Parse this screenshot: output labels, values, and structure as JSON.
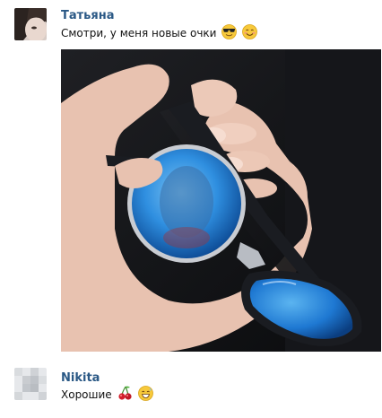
{
  "messages": [
    {
      "author": "Татьяна",
      "text": "Смотри, у меня новые очки",
      "emojis": [
        "sunglasses-face-emoji",
        "smiling-face-emoji"
      ],
      "has_photo": true
    },
    {
      "author": "Nikita",
      "text": "Хорошие",
      "emojis": [
        "cherries-emoji",
        "grinning-sweat-face-emoji"
      ],
      "has_photo": false
    }
  ],
  "colors": {
    "author": "#2a5885",
    "text": "#111111",
    "background": "#ffffff",
    "lens": "#2f8fe0",
    "frame": "#1a1c21"
  }
}
